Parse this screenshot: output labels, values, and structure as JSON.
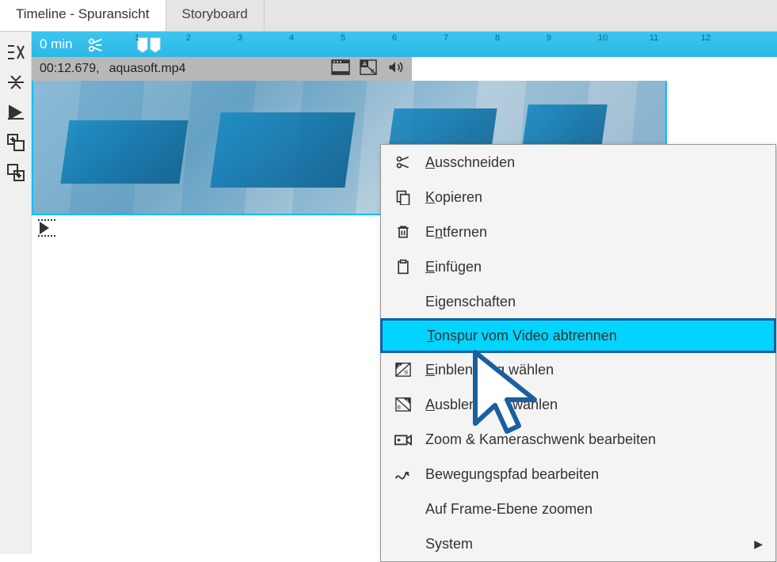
{
  "tabs": {
    "timeline": "Timeline - Spuransicht",
    "storyboard": "Storyboard"
  },
  "ruler": {
    "label": "0 min",
    "marks": [
      "1",
      "2",
      "3",
      "4",
      "5",
      "6",
      "7",
      "8",
      "9",
      "10",
      "11",
      "12"
    ]
  },
  "clip": {
    "time": "00:12.679,",
    "filename": "aquasoft.mp4"
  },
  "context_menu": {
    "cut": "Ausschneiden",
    "copy": "Kopieren",
    "remove": "Entfernen",
    "paste": "Einfügen",
    "properties": "Eigenschaften",
    "separate_audio": "Tonspur vom Video abtrennen",
    "fade_in": "Einblendung wählen",
    "fade_out": "Ausblendung wählen",
    "zoom_pan": "Zoom & Kameraschwenk bearbeiten",
    "motion_path": "Bewegungspfad bearbeiten",
    "frame_zoom": "Auf Frame-Ebene zoomen",
    "system": "System"
  }
}
